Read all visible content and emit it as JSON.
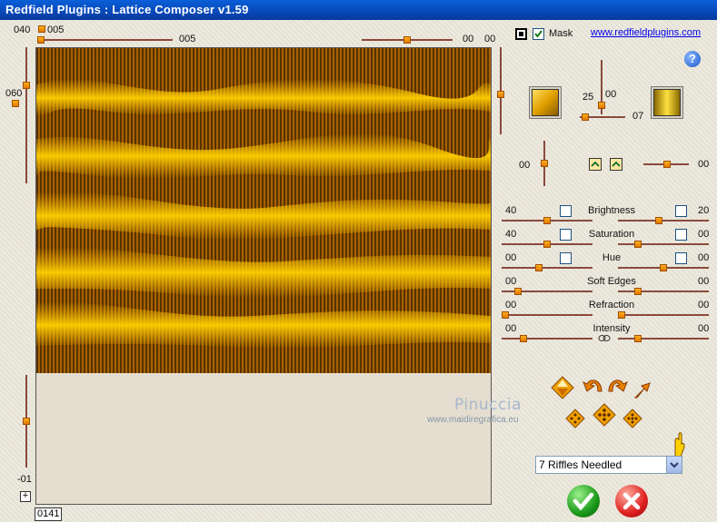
{
  "window": {
    "title": "Redfield Plugins : Lattice Composer v1.59"
  },
  "top": {
    "left_value": "040",
    "small_value": "005",
    "slider_value": "005",
    "right_val1": "00",
    "right_val2": "00"
  },
  "mask": {
    "label": "Mask",
    "checked": true
  },
  "link": "www.redfieldplugins.com",
  "left": {
    "upper_value": "060",
    "lower_value": "-01"
  },
  "frame_counter": "0141",
  "colors": {
    "accent": "#f0a000",
    "track": "#8a4a3c",
    "title_bg": "#0848b8"
  },
  "color_panel": {
    "val1": "25",
    "val2": "00",
    "val3": "07"
  },
  "mid_row": {
    "left": "00",
    "right": "00"
  },
  "adjust": [
    {
      "label": "Brightness",
      "left": "40",
      "right": "20",
      "left_pos": 0.5,
      "right_pos": 0.45
    },
    {
      "label": "Saturation",
      "left": "40",
      "right": "00",
      "left_pos": 0.5,
      "right_pos": 0.2
    },
    {
      "label": "Hue",
      "left": "00",
      "right": "00",
      "left_pos": 0.4,
      "right_pos": 0.5
    },
    {
      "label": "Soft Edges",
      "left": "00",
      "right": "00",
      "left_pos": 0.15,
      "right_pos": 0.2
    },
    {
      "label": "Refraction",
      "left": "00",
      "right": "00",
      "left_pos": 0.0,
      "right_pos": 0.0
    },
    {
      "label": "Intensity",
      "left": "00",
      "right": "00",
      "left_pos": 0.22,
      "right_pos": 0.2
    }
  ],
  "watermark": {
    "line1": "Pinuccia",
    "line2": "www.maidiregrafica.eu"
  },
  "preset": {
    "selected": "7 Riffles Needled"
  },
  "icons": {
    "help": "help-icon",
    "ok": "ok-check-icon",
    "cancel": "cancel-x-icon",
    "nav": "diamond-arrows-icon",
    "undo": "undo-arrow-icon",
    "redo": "redo-arrow-icon",
    "expand": "expand-arrow-icon",
    "dice": "dice-icon"
  }
}
